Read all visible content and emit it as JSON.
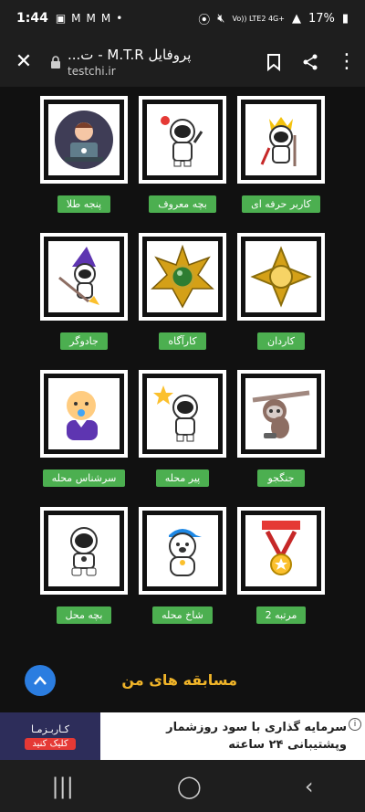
{
  "status": {
    "time": "1:44",
    "battery": "17%",
    "network": "Vo)) LTE2 4G+"
  },
  "browser": {
    "page_title": "پروفایل M.T.R - ت...",
    "domain": "testchi.ir"
  },
  "badges": [
    {
      "label": "کاربر حرفه ای",
      "icon": "astronaut-king-icon"
    },
    {
      "label": "بچه معروف",
      "icon": "astronaut-peace-icon"
    },
    {
      "label": "پنجه طلا",
      "icon": "hacker-laptop-icon"
    },
    {
      "label": "کاردان",
      "icon": "gold-cross-medal-icon"
    },
    {
      "label": "کارآگاه",
      "icon": "gold-star-medal-icon"
    },
    {
      "label": "جادوگر",
      "icon": "wizard-astronaut-icon"
    },
    {
      "label": "جنگجو",
      "icon": "sloth-icon"
    },
    {
      "label": "پیر محله",
      "icon": "astronaut-star-icon"
    },
    {
      "label": "سرشناس محله",
      "icon": "baby-icon"
    },
    {
      "label": "2 مرتبه",
      "icon": "winner-medal-icon"
    },
    {
      "label": "شاخ محله",
      "icon": "bear-cap-icon"
    },
    {
      "label": "بچه محل",
      "icon": "astronaut-sitting-icon"
    }
  ],
  "section_title": "مسابقه های من",
  "ad": {
    "text_line1": "سرمایه گذاری با سود روزشمار",
    "text_line2": "وپشتیبانی ۲۴ ساعته",
    "brand": "کـاربـزمـا",
    "cta": "کلیک کنید"
  },
  "colors": {
    "label_bg": "#4caf50",
    "title": "#f0b429",
    "fab": "#2b7de0"
  }
}
